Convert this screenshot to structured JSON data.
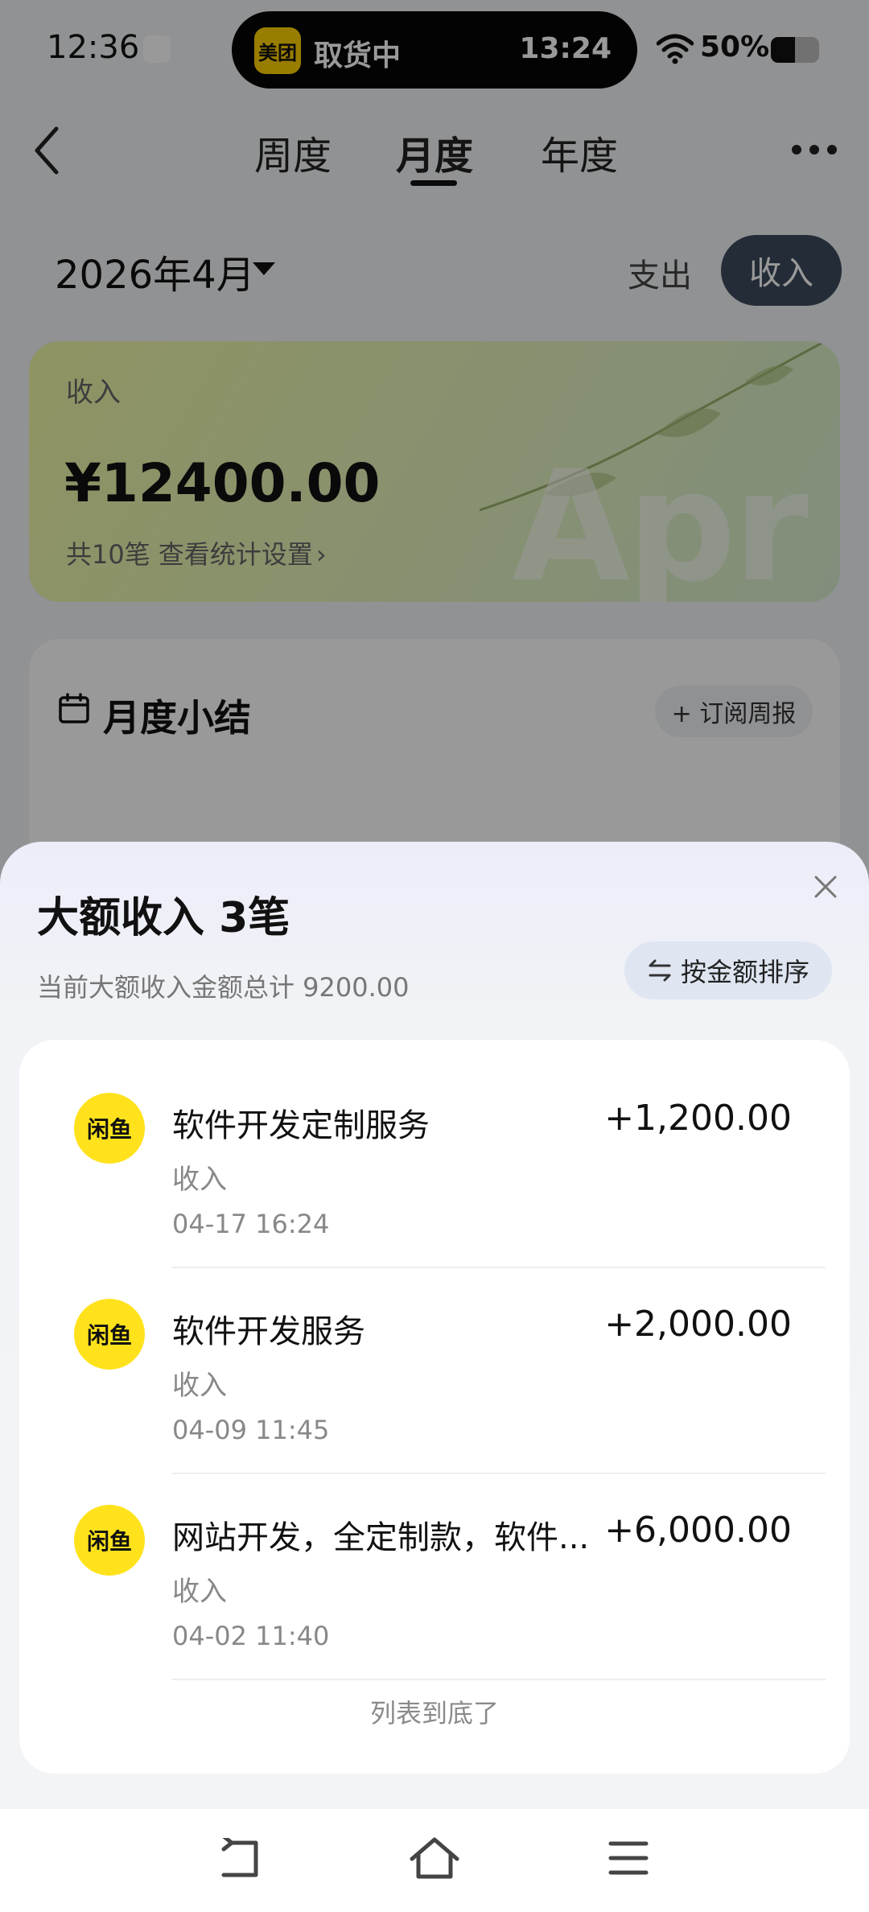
{
  "status_bar": {
    "time": "12:36",
    "island_app": "美团",
    "island_text": "取货中",
    "island_time": "13:24",
    "battery": "50%",
    "battery_level": 0.5
  },
  "header": {
    "tabs": [
      {
        "label": "周度",
        "active": false
      },
      {
        "label": "月度",
        "active": true
      },
      {
        "label": "年度",
        "active": false
      }
    ]
  },
  "period": {
    "label": "2026年4月",
    "toggle_expense": "支出",
    "toggle_income": "收入"
  },
  "income_card": {
    "label": "收入",
    "amount": "¥12400.00",
    "sub": "共10笔  查看统计设置",
    "watermark": "Apr"
  },
  "summary": {
    "title": "月度小结",
    "subscribe": "+ 订阅周报"
  },
  "sheet": {
    "title": "大额收入 3笔",
    "subtitle": "当前大额收入金额总计 9200.00",
    "sort_label": "按金额排序",
    "items": [
      {
        "avatar": "闲鱼",
        "title": "软件开发定制服务",
        "category": "收入",
        "date": "04-17 16:24",
        "amount": "+1,200.00"
      },
      {
        "avatar": "闲鱼",
        "title": "软件开发服务",
        "category": "收入",
        "date": "04-09 11:45",
        "amount": "+2,000.00"
      },
      {
        "avatar": "闲鱼",
        "title": "网站开发，全定制款，软件...",
        "category": "收入",
        "date": "04-02 11:40",
        "amount": "+6,000.00"
      }
    ],
    "end_text": "列表到底了"
  },
  "colors": {
    "accent_dark": "#3c4a5c",
    "card_green": "#eef7a4",
    "avatar_yellow": "#ffe21c"
  }
}
